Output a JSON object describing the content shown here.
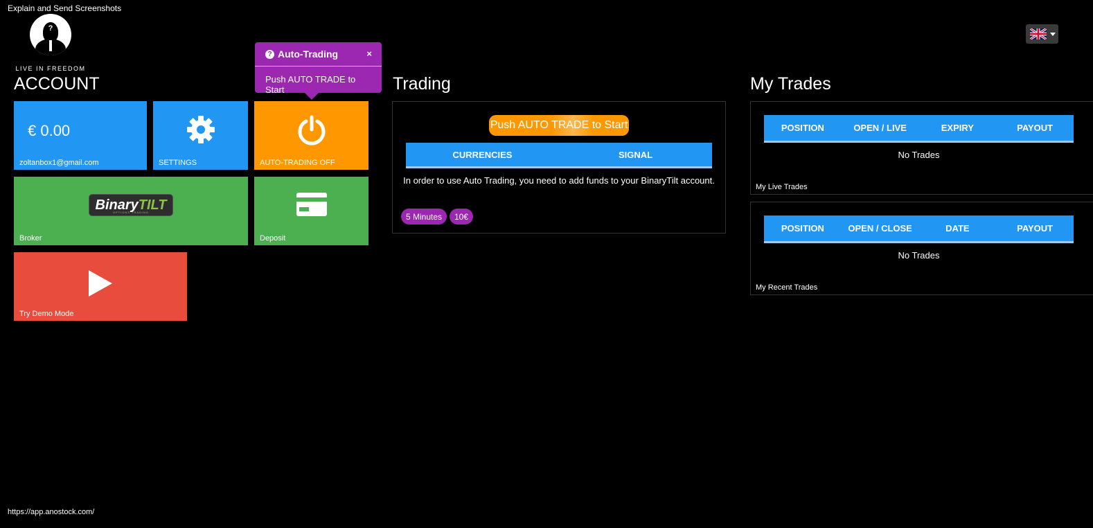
{
  "top_caption": "Explain and Send Screenshots",
  "footer_url": "https://app.anostock.com/",
  "logo": {
    "mark": "?",
    "tagline": "LIVE IN FREEDOM"
  },
  "language": {
    "icon": "uk-flag-icon"
  },
  "account": {
    "title": "ACCOUNT",
    "balance_tile": {
      "balance": "€ 0.00",
      "email": "zoltanbox1@gmail.com"
    },
    "settings_tile": {
      "label": "SETTINGS",
      "icon": "gear-icon"
    },
    "autotrade_tile": {
      "label": "AUTO-TRADING OFF",
      "icon": "power-icon"
    },
    "broker_tile": {
      "label": "Broker",
      "logo_word1": "Binary",
      "logo_word2": "TILT",
      "logo_sub": "OPTIONS TRADING"
    },
    "deposit_tile": {
      "label": "Deposit",
      "icon": "credit-card-icon"
    },
    "demo_tile": {
      "label": "Try Demo Mode",
      "icon": "play-icon"
    }
  },
  "popover": {
    "title": "Auto-Trading",
    "close": "×",
    "body": "Push AUTO TRADE to Start"
  },
  "trading": {
    "title": "Trading",
    "push_button": "Push AUTO TRADE to Start",
    "columns": [
      "CURRENCIES",
      "SIGNAL"
    ],
    "info": "In order to use Auto Trading, you need to add funds to your BinaryTilt account.",
    "pills": [
      "5 Minutes",
      "10€"
    ]
  },
  "my_trades": {
    "title": "My Trades",
    "live": {
      "columns": [
        "POSITION",
        "OPEN / LIVE",
        "EXPIRY",
        "PAYOUT"
      ],
      "empty": "No Trades",
      "caption": "My Live Trades"
    },
    "recent": {
      "columns": [
        "POSITION",
        "OPEN / CLOSE",
        "DATE",
        "PAYOUT"
      ],
      "empty": "No Trades",
      "caption": "My Recent Trades"
    }
  },
  "colors": {
    "blue": "#2196f3",
    "orange": "#ff9800",
    "green": "#4caf50",
    "red": "#e74c3c",
    "purple": "#9c27b0"
  }
}
